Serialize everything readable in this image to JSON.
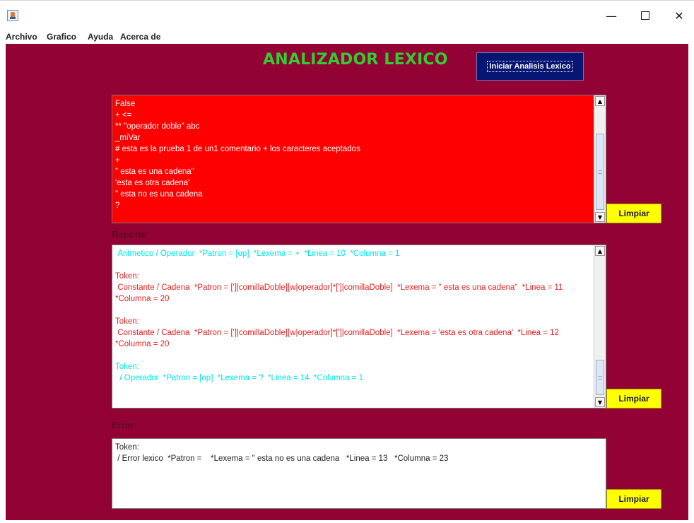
{
  "window": {
    "minimize_glyph": "—",
    "close_glyph": "✕",
    "icon": "java-app-icon"
  },
  "menu": [
    "Archivo",
    "Grafico",
    "Ayuda",
    "Acerca de"
  ],
  "header": {
    "title": "ANALIZADOR LEXICO",
    "start_button": "Iniciar Analisis Lexico"
  },
  "colors": {
    "background": "#930234",
    "title": "#33cc33",
    "input_bg": "#ff0000",
    "clear_button": "#ffff00",
    "start_button": "#071673",
    "cyan_text": "#00e6e6",
    "red_text": "#e61e1e"
  },
  "input_panel": {
    "lines": [
      "False",
      "+ <=",
      "** \"operador doble\" abc",
      "_miVar",
      "# esta es la prueba 1 de un1 comentario + los caracteres aceptados",
      "+",
      "\" esta es una cadena\"",
      "'esta es otra cadena'",
      "\" esta no es una cadena",
      "?"
    ],
    "clear_button": "Limpiar"
  },
  "report_panel": {
    "label": "Reporte",
    "lines": [
      {
        "text": " Aritmetico / Operador  *Patron = [op]  *Lexema = +  *Linea = 10  *Columna = 1",
        "color": "cyan"
      },
      {
        "text": "",
        "color": "red"
      },
      {
        "text": "Token:",
        "color": "red"
      },
      {
        "text": " Constante / Cadena  *Patron = [']|comillaDoble][w|operador]*[']|comillaDoble]  *Lexema = \" esta es una cadena\"  *Linea = 11  *Columna = 20",
        "color": "red"
      },
      {
        "text": "",
        "color": "red"
      },
      {
        "text": "Token:",
        "color": "red"
      },
      {
        "text": " Constante / Cadena  *Patron = [']|comillaDoble][w|operador]*[']|comillaDoble]  *Lexema = 'esta es otra cadena'  *Linea = 12  *Columna = 20",
        "color": "red"
      },
      {
        "text": "",
        "color": "cyan"
      },
      {
        "text": "Token:",
        "color": "cyan"
      },
      {
        "text": "  / Operador  *Patron = [op]  *Lexema = ?  *Linea = 14  *Columna = 1",
        "color": "cyan"
      }
    ],
    "clear_button": "Limpiar"
  },
  "error_panel": {
    "label": "Error",
    "lines": [
      "Token:",
      " / Error lexico  *Patron =    *Lexema = \" esta no es una cadena   *Linea = 13   *Columna = 23"
    ],
    "clear_button": "Limpiar"
  }
}
